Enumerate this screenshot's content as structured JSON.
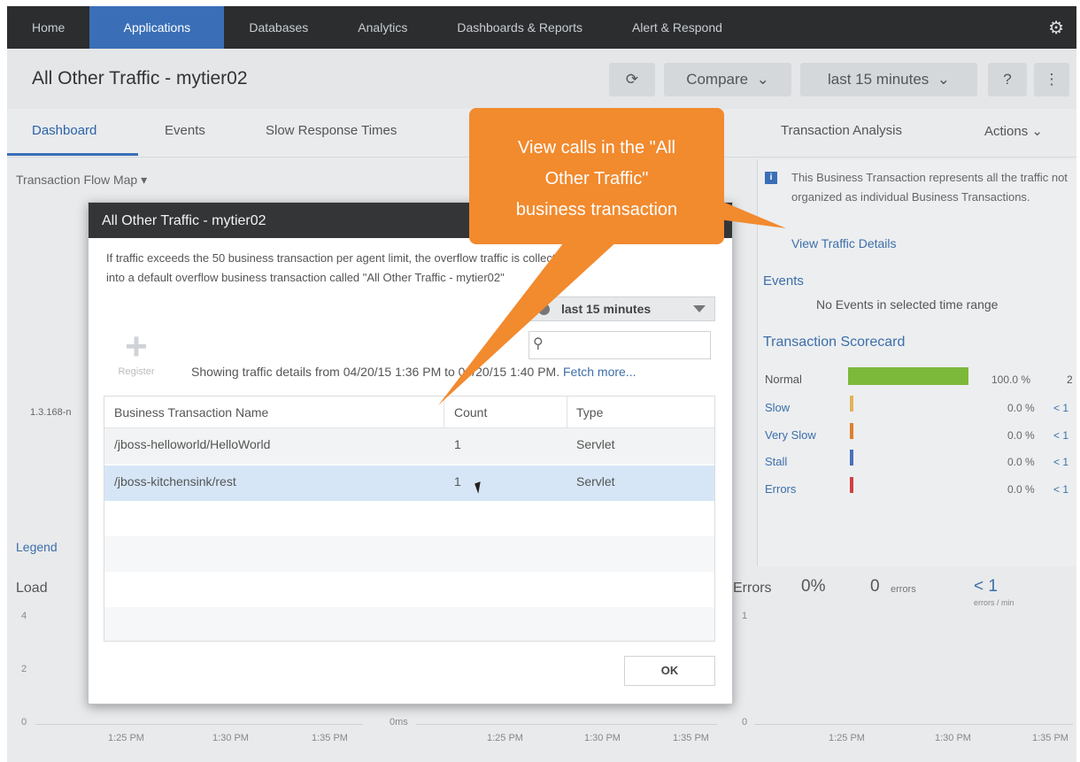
{
  "nav": {
    "items": [
      "Home",
      "Applications",
      "Databases",
      "Analytics",
      "Dashboards & Reports",
      "Alert & Respond"
    ],
    "active": "Applications"
  },
  "header": {
    "title": "All Other Traffic - mytier02",
    "compare": "Compare",
    "time_range": "last 15 minutes",
    "help": "?",
    "more": "⋮"
  },
  "tabs": [
    "Dashboard",
    "Events",
    "Slow Response Times",
    "Transaction Analysis",
    "Actions"
  ],
  "left": {
    "flow_map": "Transaction Flow Map ▾",
    "node_ip": "1.3.168-n",
    "legend": "Legend",
    "load": "Load"
  },
  "right_panel": {
    "info": "This Business Transaction represents all the traffic not organized as individual Business Transactions.",
    "view_details": "View Traffic Details",
    "events_title": "Events",
    "events_none": "No Events in selected time range",
    "scorecard_title": "Transaction Scorecard",
    "scorecard": [
      {
        "label": "Normal",
        "pct": "100.0 %",
        "lt": "2"
      },
      {
        "label": "Slow",
        "pct": "0.0 %",
        "lt": "< 1"
      },
      {
        "label": "Very Slow",
        "pct": "0.0 %",
        "lt": "< 1"
      },
      {
        "label": "Stall",
        "pct": "0.0 %",
        "lt": "< 1"
      },
      {
        "label": "Errors",
        "pct": "0.0 %",
        "lt": "< 1"
      }
    ],
    "errors_label": "Errors",
    "errors_pct": "0%",
    "errors_count": "0",
    "errors_word": "errors",
    "errors_rate": "< 1",
    "errors_rate_unit": "errors / min"
  },
  "charts": {
    "load_ticks": [
      "4",
      "2",
      "0"
    ],
    "time_ticks": [
      "1:25 PM",
      "1:30 PM",
      "1:35 PM"
    ],
    "ms_label": "0ms",
    "error_ticks": [
      "1",
      "0"
    ]
  },
  "modal": {
    "title": "All Other Traffic - mytier02",
    "desc_1": "If traffic exceeds the 50 business transaction per agent limit, the overflow traffic is collected",
    "desc_2": "into a default overflow business transaction called \"All Other Traffic - mytier02\"",
    "time_select": "last 15 minutes",
    "register": "Register",
    "showing": "Showing traffic details from 04/20/15 1:36 PM to 04/20/15 1:40 PM.",
    "fetch_more": "Fetch more...",
    "columns": [
      "Business Transaction Name",
      "Count",
      "Type"
    ],
    "rows": [
      {
        "name": "/jboss-helloworld/HelloWorld",
        "count": "1",
        "type": "Servlet"
      },
      {
        "name": "/jboss-kitchensink/rest",
        "count": "1",
        "type": "Servlet"
      }
    ],
    "ok": "OK"
  },
  "callout": {
    "line1": "View calls in the \"All",
    "line2": "Other Traffic\"",
    "line3": "business transaction"
  }
}
